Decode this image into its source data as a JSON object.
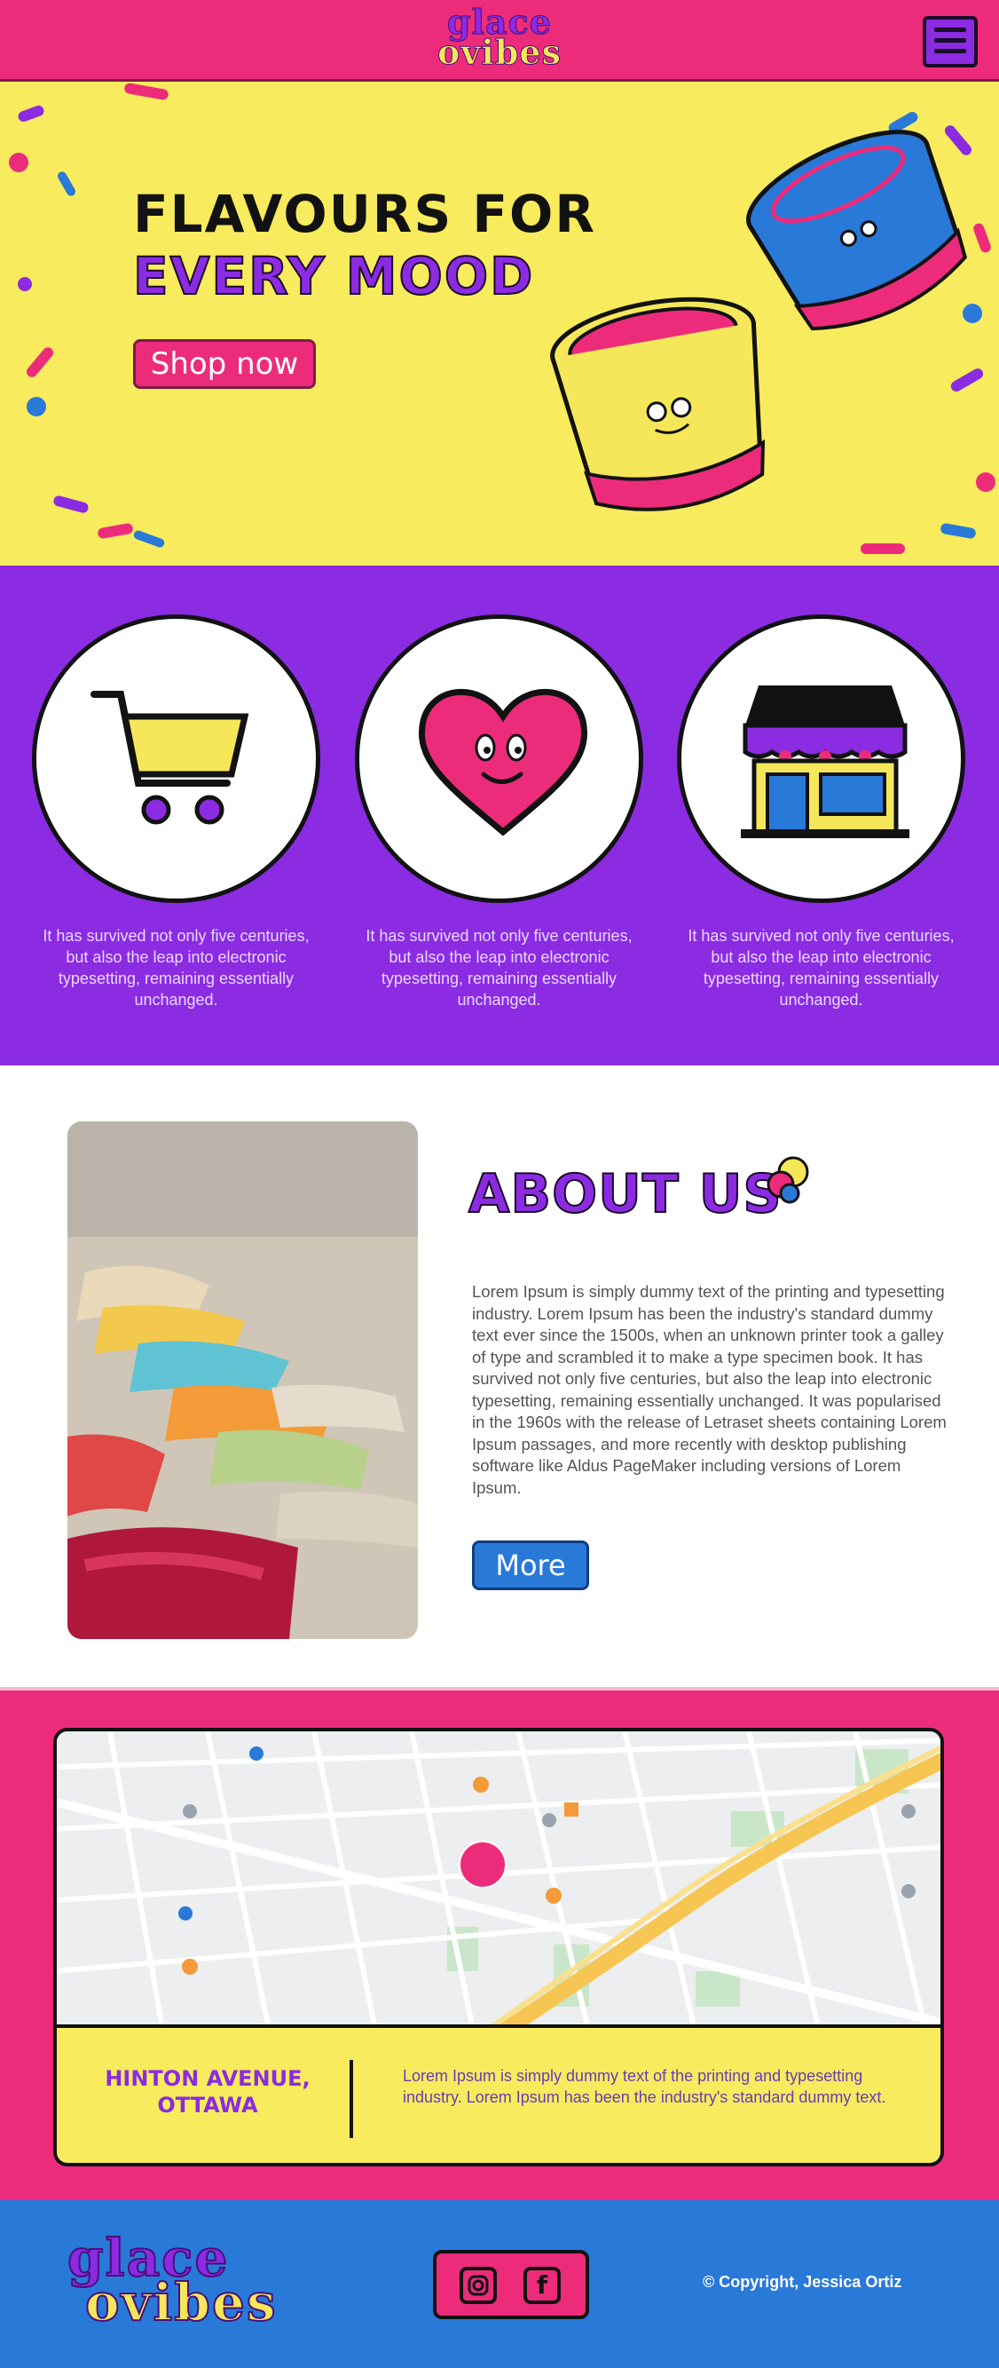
{
  "header": {
    "logo_line1": "glace",
    "logo_line2": "ovibes"
  },
  "hero": {
    "title_line1": "FLAVOURS FOR",
    "title_line2": "EVERY MOOD",
    "shop_label": "Shop now"
  },
  "features": [
    {
      "icon": "shopping-cart-icon",
      "text": "It has survived not only five centuries, but also the leap into electronic typesetting, remaining essentially unchanged."
    },
    {
      "icon": "heart-face-icon",
      "text": "It has survived not only five centuries, but also the leap into electronic typesetting, remaining essentially unchanged."
    },
    {
      "icon": "storefront-icon",
      "text": "It has survived not only five centuries, but also the leap into electronic typesetting, remaining essentially unchanged."
    }
  ],
  "about": {
    "title": "ABOUT US",
    "text": "Lorem Ipsum is simply dummy text of the printing and typesetting industry. Lorem Ipsum has been the industry's standard dummy text ever since the 1500s, when an unknown printer took a galley of type and scrambled it to make a type specimen book. It has survived not only five centuries, but also the leap into electronic typesetting, remaining essentially unchanged. It was popularised in the 1960s with the release of Letraset sheets containing Lorem Ipsum passages, and more recently with desktop publishing software like Aldus PageMaker including versions of Lorem Ipsum.",
    "more_label": "More"
  },
  "contact": {
    "address_line1": "HINTON AVENUE,",
    "address_line2": "OTTAWA",
    "text": "Lorem Ipsum is simply dummy text of the printing and typesetting industry. Lorem Ipsum has been the industry's standard dummy text."
  },
  "footer": {
    "logo_line1": "glace",
    "logo_line2": "ovibes",
    "instagram_icon": "instagram-icon",
    "facebook_icon": "facebook-icon",
    "copyright": "© Copyright, Jessica Ortiz"
  },
  "colors": {
    "pink": "#ec2c7b",
    "yellow": "#f8eb5d",
    "purple": "#8b2be2",
    "blue": "#2979d8"
  }
}
